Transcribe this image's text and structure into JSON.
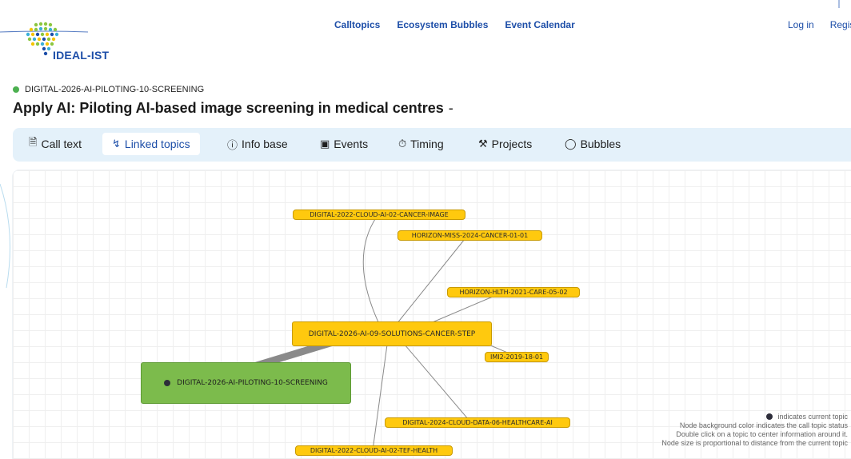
{
  "header": {
    "logo_text": "IDEAL-IST",
    "nav": [
      "Calltopics",
      "Ecosystem Bubbles",
      "Event Calendar"
    ],
    "login_label": "Log in",
    "register_label": "Regis"
  },
  "topic": {
    "code": "DIGITAL-2026-AI-PILOTING-10-SCREENING",
    "title": "Apply AI: Piloting AI-based image screening in medical centres",
    "title_suffix": "-",
    "status_color": "#4cb050"
  },
  "tabs": [
    {
      "label": "Call text",
      "icon": "document-icon"
    },
    {
      "label": "Linked topics",
      "icon": "network-icon",
      "active": true
    },
    {
      "label": "Info base",
      "icon": "info-icon"
    },
    {
      "label": "Events",
      "icon": "calendar-icon"
    },
    {
      "label": "Timing",
      "icon": "timer-icon"
    },
    {
      "label": "Projects",
      "icon": "tools-icon"
    },
    {
      "label": "Bubbles",
      "icon": "bubble-icon"
    }
  ],
  "graph": {
    "current_node": "DIGITAL-2026-AI-PILOTING-10-SCREENING",
    "center_node": "DIGITAL-2026-AI-09-SOLUTIONS-CANCER-STEP",
    "linked_nodes": [
      "DIGITAL-2022-CLOUD-AI-02-CANCER-IMAGE",
      "HORIZON-MISS-2024-CANCER-01-01",
      "HORIZON-HLTH-2021-CARE-05-02",
      "IMI2-2019-18-01",
      "DIGITAL-2024-CLOUD-DATA-06-HEALTHCARE-AI",
      "DIGITAL-2022-CLOUD-AI-02-TEF-HEALTH"
    ],
    "node_color": "#ffc90e",
    "current_color": "#7cbb4c"
  },
  "legend": {
    "line1": "indicates current topic",
    "line2": "Node background color indicates the call topic status",
    "line3": "Double click on a topic to center information around it.",
    "line4": "Node size is proportional to distance from the current topic"
  }
}
